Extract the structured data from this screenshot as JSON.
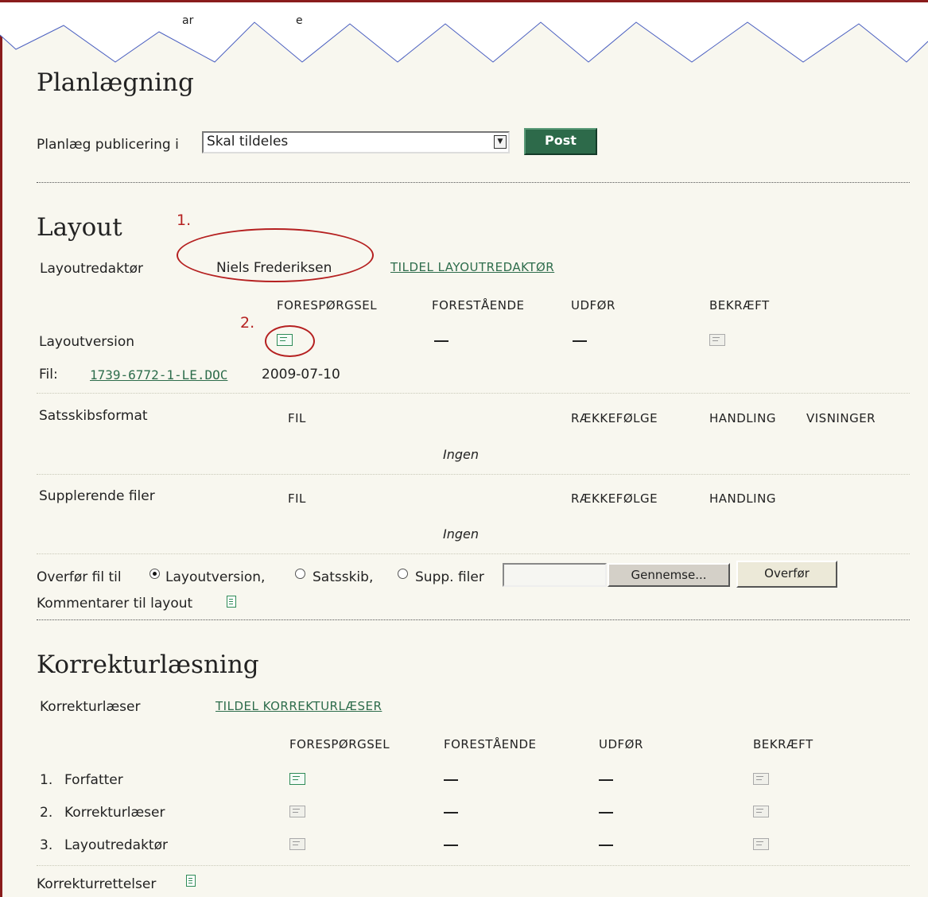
{
  "annotations": {
    "one": "1.",
    "two": "2."
  },
  "top_fragments": [
    "ar",
    "e"
  ],
  "scheduling": {
    "heading": "Planlægning",
    "label": "Planlæg publicering i",
    "selected": "Skal tildeles",
    "post_label": "Post"
  },
  "layout": {
    "heading": "Layout",
    "editor_label": "Layoutredaktør",
    "editor_name": "Niels Frederiksen",
    "assign_link": "TILDEL LAYOUTREDAKTØR",
    "columns": [
      "FORESPØRGSEL",
      "FORESTÅENDE",
      "UDFØR",
      "BEKRÆFT"
    ],
    "version_label": "Layoutversion",
    "file_label": "Fil:",
    "file_name": "1739-6772-1-LE.DOC",
    "file_date": "2009-07-10",
    "galley": {
      "label": "Satsskibsformat",
      "col_file": "FIL",
      "col_order": "RÆKKEFØLGE",
      "col_action": "HANDLING",
      "col_views": "VISNINGER",
      "empty": "Ingen"
    },
    "supp": {
      "label": "Supplerende filer",
      "col_file": "FIL",
      "col_order": "RÆKKEFØLGE",
      "col_action": "HANDLING",
      "empty": "Ingen"
    },
    "upload": {
      "label": "Overfør fil til",
      "options": [
        "Layoutversion,",
        "Satsskib,",
        "Supp. filer"
      ],
      "selected": "Layoutversion,",
      "browse_label": "Gennemse...",
      "upload_label": "Overfør"
    },
    "comments_label": "Kommentarer til layout"
  },
  "proofreading": {
    "heading": "Korrekturlæsning",
    "proofreader_label": "Korrekturlæser",
    "assign_link": "TILDEL KORREKTURLÆSER",
    "columns": [
      "FORESPØRGSEL",
      "FORESTÅENDE",
      "UDFØR",
      "BEKRÆFT"
    ],
    "rows": [
      {
        "num": "1.",
        "label": "Forfatter"
      },
      {
        "num": "2.",
        "label": "Korrekturlæser"
      },
      {
        "num": "3.",
        "label": "Layoutredaktør"
      }
    ],
    "corrections_label": "Korrekturrettelser"
  },
  "dash": "—"
}
